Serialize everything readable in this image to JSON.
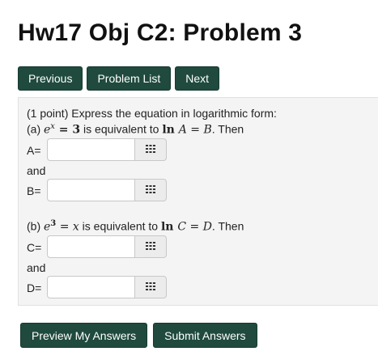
{
  "page": {
    "title": "Hw17 Obj C2: Problem 3"
  },
  "nav": {
    "previous": "Previous",
    "problem_list": "Problem List",
    "next": "Next"
  },
  "problem": {
    "intro": "(1 point) Express the equation in logarithmic form:",
    "a_prefix": "(a) ",
    "a_eq_base": "e",
    "a_eq_exp": "x",
    "a_eq_rhs": " = 3",
    "a_mid": " is equivalent to ",
    "a_log": "ln ",
    "a_log_arg": "A",
    "a_log_rhs": " = B",
    "a_suffix": ". Then",
    "b_prefix": "(b) ",
    "b_eq_base": "e",
    "b_eq_exp": "3",
    "b_eq_rhs": " = x",
    "b_mid": " is equivalent to ",
    "b_log": "ln ",
    "b_log_arg": "C",
    "b_log_rhs": " = D",
    "b_suffix": ". Then",
    "and1": "and",
    "and2": "and",
    "fields": [
      {
        "label": "A=",
        "value": ""
      },
      {
        "label": "B=",
        "value": ""
      },
      {
        "label": "C=",
        "value": ""
      },
      {
        "label": "D=",
        "value": ""
      }
    ],
    "keyboard_icon": "keypad-grid-icon"
  },
  "actions": {
    "preview": "Preview My Answers",
    "submit": "Submit Answers"
  }
}
